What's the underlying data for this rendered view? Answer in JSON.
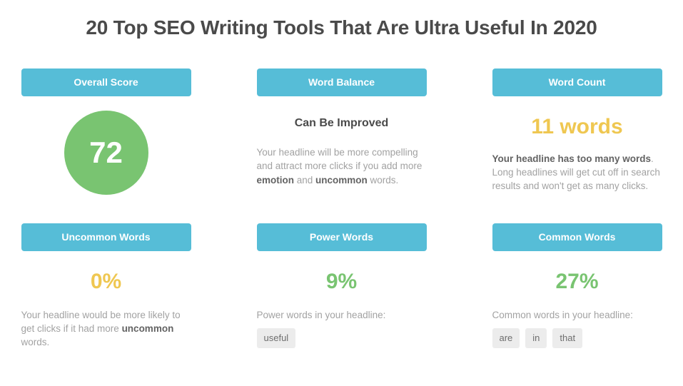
{
  "headline": "20 Top SEO Writing Tools That Are Ultra Useful In 2020",
  "colors": {
    "header_teal": "#56bdd7",
    "green": "#79c471",
    "yellow": "#efc751",
    "chip_bg": "#ececec",
    "body_text": "#a2a2a2",
    "dark_text": "#4a4a4a"
  },
  "cards": {
    "overall_score": {
      "title": "Overall Score",
      "value": "72"
    },
    "word_balance": {
      "title": "Word Balance",
      "status": "Can Be Improved",
      "description_parts": [
        {
          "text": "Your headline will be more compelling and attract more clicks if you add more ",
          "bold": false
        },
        {
          "text": "emotion",
          "bold": true
        },
        {
          "text": " and ",
          "bold": false
        },
        {
          "text": "uncommon",
          "bold": true
        },
        {
          "text": " words.",
          "bold": false
        }
      ],
      "description_plain": "Your headline will be more compelling and attract more clicks if you add more emotion and uncommon words."
    },
    "word_count": {
      "title": "Word Count",
      "value": "11 words",
      "description_parts": [
        {
          "text": "Your headline has too many words",
          "bold": true
        },
        {
          "text": ". Long headlines will get cut off in search results and won't get as many clicks.",
          "bold": false
        }
      ],
      "description_plain": "Your headline has too many words. Long headlines will get cut off in search results and won't get as many clicks."
    },
    "uncommon_words": {
      "title": "Uncommon Words",
      "value": "0%",
      "description_parts": [
        {
          "text": "Your headline would be more likely to get clicks if it had more ",
          "bold": false
        },
        {
          "text": "uncommon",
          "bold": true
        },
        {
          "text": " words.",
          "bold": false
        }
      ],
      "description_plain": "Your headline would be more likely to get clicks if it had more uncommon words."
    },
    "power_words": {
      "title": "Power Words",
      "value": "9%",
      "chips_label": "Power words in your headline:",
      "chips": [
        "useful"
      ]
    },
    "common_words": {
      "title": "Common Words",
      "value": "27%",
      "chips_label": "Common words in your headline:",
      "chips": [
        "are",
        "in",
        "that"
      ]
    }
  }
}
